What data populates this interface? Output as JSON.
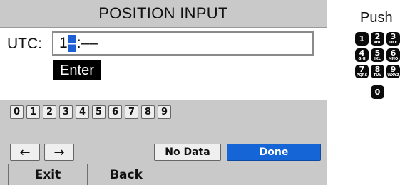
{
  "screen": {
    "title": "POSITION INPUT",
    "utc_label": "UTC:",
    "utc_value": {
      "before": "1",
      "cursor": "–",
      "after": ":––"
    },
    "enter_label": "Enter",
    "digits": [
      "0",
      "1",
      "2",
      "3",
      "4",
      "5",
      "6",
      "7",
      "8",
      "9"
    ],
    "left_arrow": "←",
    "right_arrow": "→",
    "no_data_label": "No Data",
    "done_label": "Done",
    "softkeys": [
      "Exit",
      "Back",
      "",
      ""
    ]
  },
  "legend": {
    "push_label": "Push",
    "keys": [
      {
        "digit": "1",
        "letters": ""
      },
      {
        "digit": "2",
        "letters": "ABC"
      },
      {
        "digit": "3",
        "letters": "DEF"
      },
      {
        "digit": "4",
        "letters": "GHI"
      },
      {
        "digit": "5",
        "letters": "JKL"
      },
      {
        "digit": "6",
        "letters": "MNO"
      },
      {
        "digit": "7",
        "letters": "PQRS"
      },
      {
        "digit": "8",
        "letters": "TUV"
      },
      {
        "digit": "9",
        "letters": "WXYZ"
      },
      {
        "digit": "0",
        "letters": ""
      }
    ]
  },
  "colors": {
    "panel_gray": "#c9c9c9",
    "accent_blue": "#1565d6",
    "key_black": "#0b0b0b"
  }
}
